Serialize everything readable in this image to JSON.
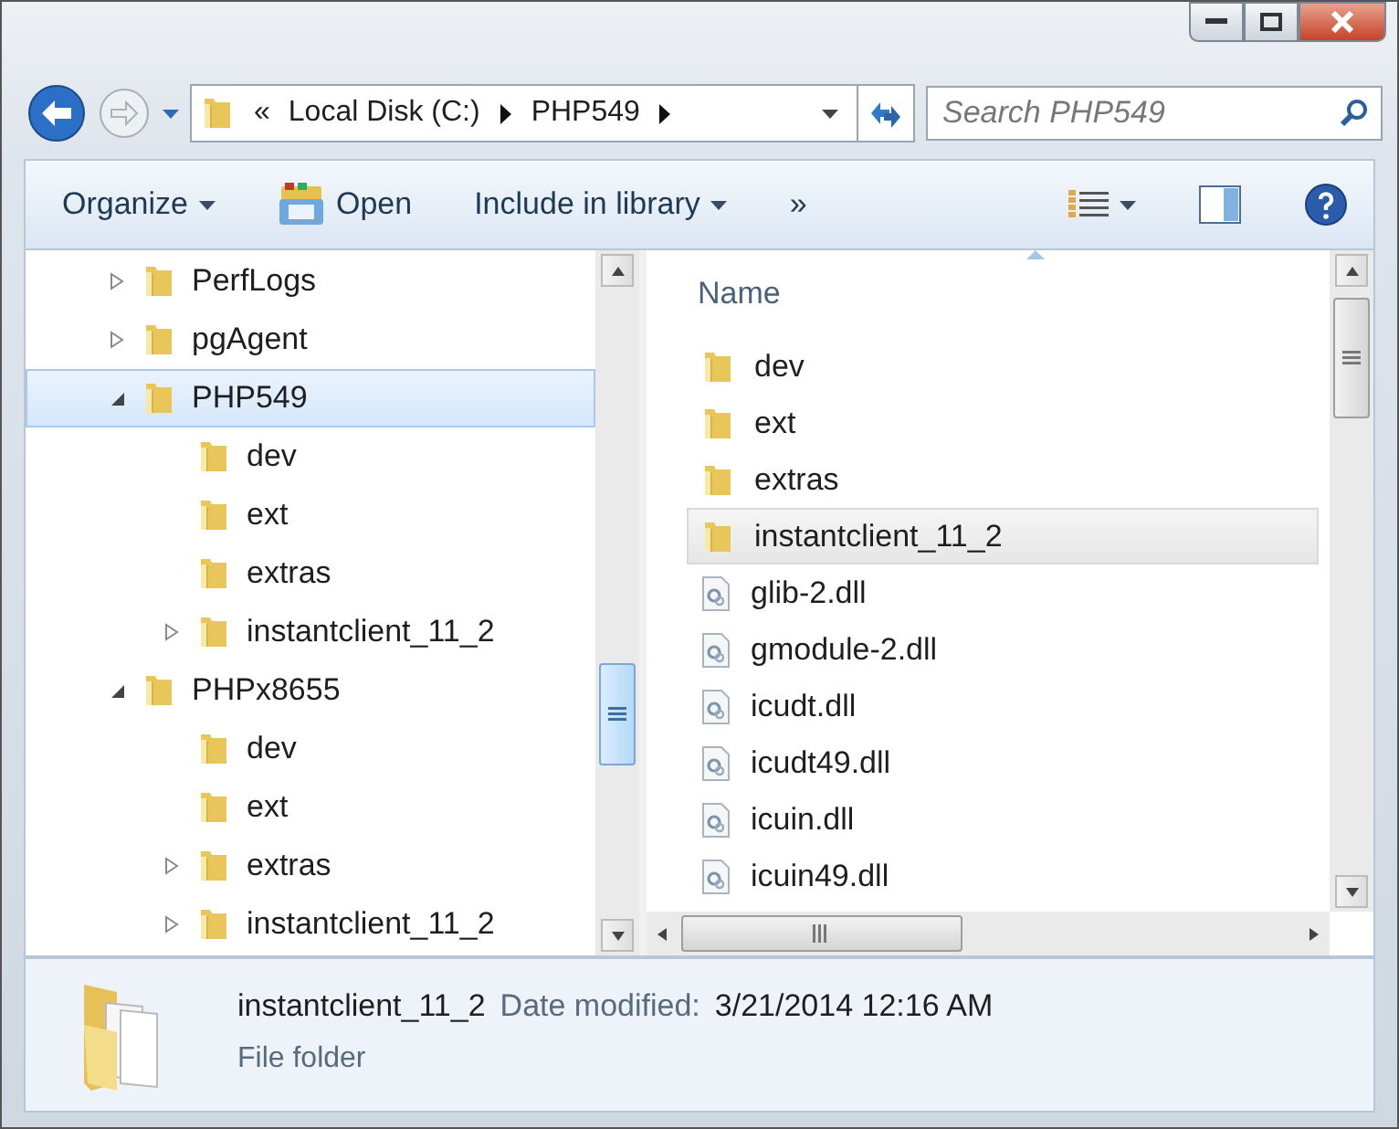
{
  "address_bar": {
    "overflow": "«",
    "crumbs": [
      "Local Disk (C:)",
      "PHP549"
    ]
  },
  "search": {
    "placeholder": "Search PHP549"
  },
  "toolbar": {
    "items": [
      {
        "label": "Organize",
        "kind": "menu"
      },
      {
        "label": "Open",
        "kind": "open"
      },
      {
        "label": "Include in library",
        "kind": "menu"
      },
      {
        "label": "»",
        "kind": "more"
      }
    ]
  },
  "tree": {
    "items": [
      {
        "label": "PerfLogs",
        "expanded": false,
        "selected": false
      },
      {
        "label": "pgAgent",
        "expanded": false,
        "selected": false
      },
      {
        "label": "PHP549",
        "expanded": true,
        "selected": true,
        "children": [
          {
            "label": "dev",
            "selected": false
          },
          {
            "label": "ext",
            "selected": false
          },
          {
            "label": "extras",
            "selected": false
          },
          {
            "label": "instantclient_11_2",
            "expanded": false,
            "selected": false
          }
        ]
      },
      {
        "label": "PHPx8655",
        "expanded": true,
        "selected": false,
        "children": [
          {
            "label": "dev",
            "selected": false
          },
          {
            "label": "ext",
            "selected": false
          },
          {
            "label": "extras",
            "expanded": false,
            "selected": false
          },
          {
            "label": "instantclient_11_2",
            "expanded": false,
            "selected": false
          }
        ]
      }
    ]
  },
  "files": {
    "column": "Name",
    "rows": [
      {
        "name": "dev",
        "kind": "folder",
        "selected": false
      },
      {
        "name": "ext",
        "kind": "folder",
        "selected": false
      },
      {
        "name": "extras",
        "kind": "folder",
        "selected": false
      },
      {
        "name": "instantclient_11_2",
        "kind": "folder",
        "selected": true
      },
      {
        "name": "glib-2.dll",
        "kind": "dll",
        "selected": false
      },
      {
        "name": "gmodule-2.dll",
        "kind": "dll",
        "selected": false
      },
      {
        "name": "icudt.dll",
        "kind": "dll",
        "selected": false
      },
      {
        "name": "icudt49.dll",
        "kind": "dll",
        "selected": false
      },
      {
        "name": "icuin.dll",
        "kind": "dll",
        "selected": false
      },
      {
        "name": "icuin49.dll",
        "kind": "dll",
        "selected": false
      }
    ]
  },
  "details": {
    "name": "instantclient_11_2",
    "date_label": "Date modified:",
    "date": "3/21/2014 12:16 AM",
    "type": "File folder"
  }
}
